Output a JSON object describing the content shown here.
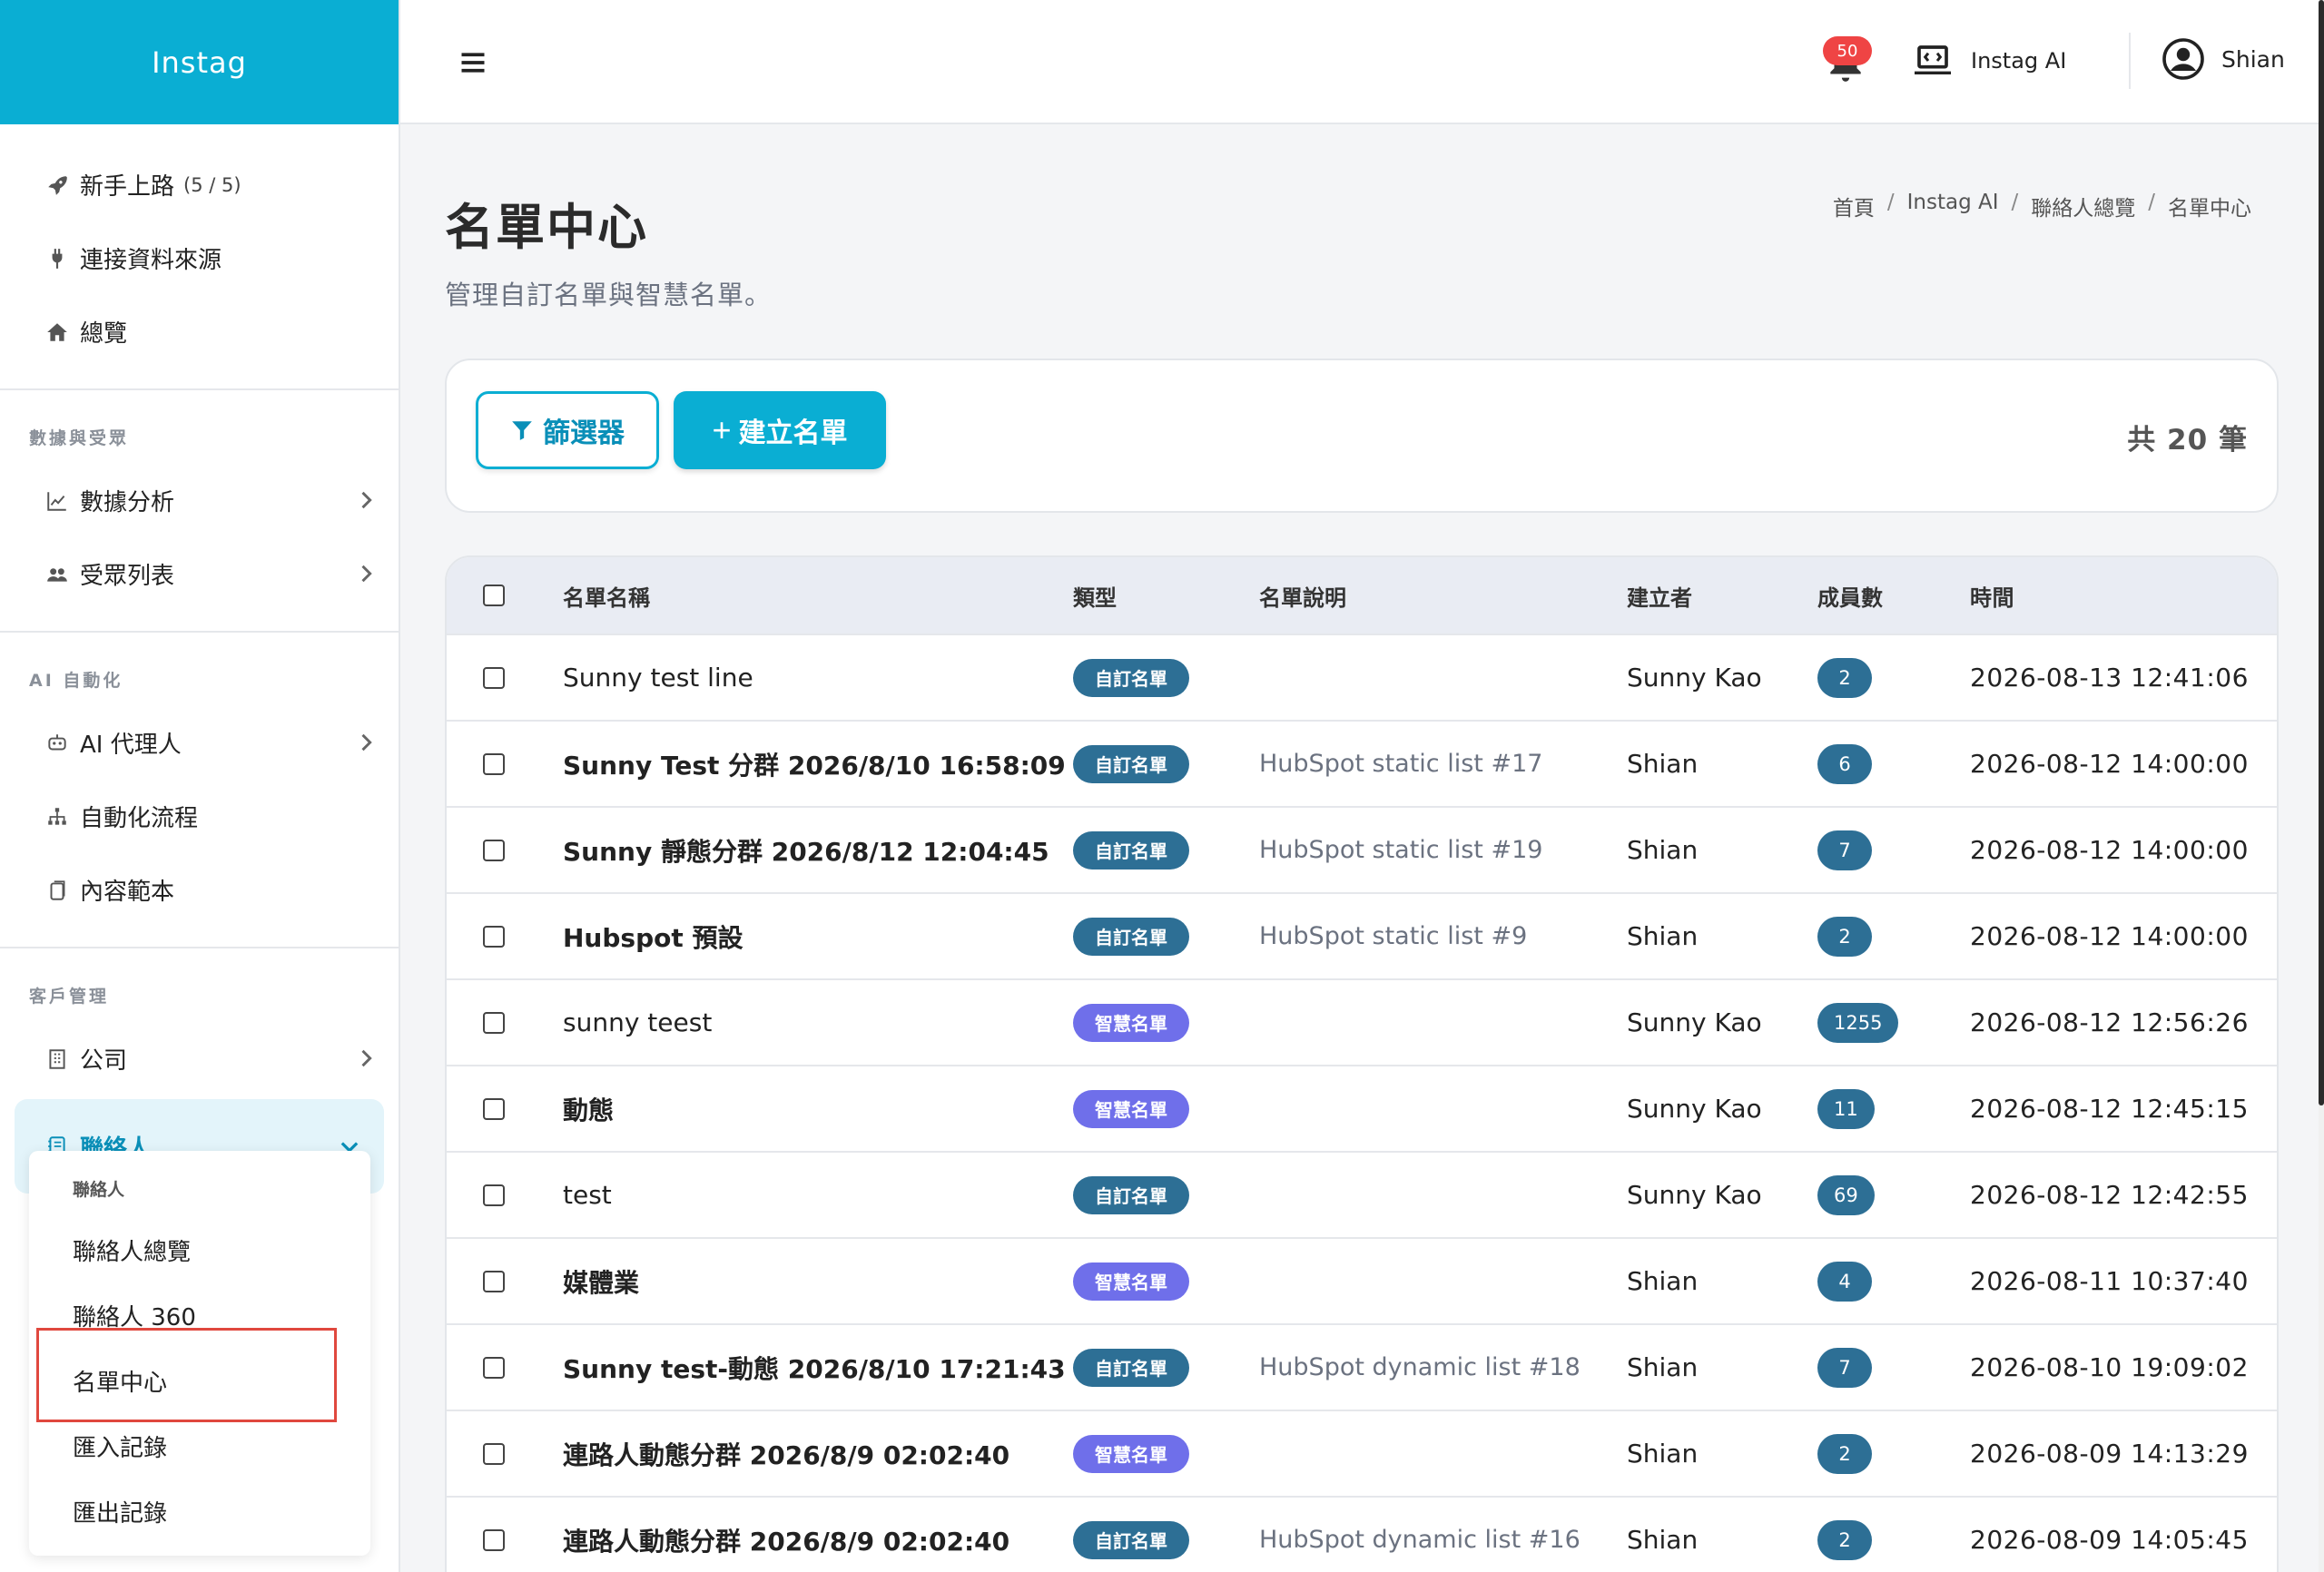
{
  "sidebar": {
    "brand": "Instag",
    "top_items": [
      {
        "label": "新手上路",
        "count": "(5 / 5)"
      },
      {
        "label": "連接資料來源"
      },
      {
        "label": "總覽"
      }
    ],
    "groups": [
      {
        "title": "數據與受眾",
        "items": [
          {
            "label": "數據分析"
          },
          {
            "label": "受眾列表"
          }
        ]
      },
      {
        "title": "AI 自動化",
        "items": [
          {
            "label": "AI 代理人"
          },
          {
            "label": "自動化流程"
          },
          {
            "label": "內容範本"
          }
        ]
      },
      {
        "title": "客戶管理",
        "items": [
          {
            "label": "公司"
          },
          {
            "label": "聯絡人"
          }
        ]
      }
    ],
    "submenu": {
      "title": "聯絡人",
      "items": [
        {
          "label": "聯絡人總覽"
        },
        {
          "label": "聯絡人 360"
        },
        {
          "label": "名單中心"
        },
        {
          "label": "匯入記錄"
        },
        {
          "label": "匯出記錄"
        }
      ]
    }
  },
  "header": {
    "notification_count": "50",
    "ai_label": "Instag AI",
    "user_name": "Shian"
  },
  "page": {
    "title": "名單中心",
    "subtitle": "管理自訂名單與智慧名單。",
    "breadcrumb": [
      "首頁",
      "Instag AI",
      "聯絡人總覽",
      "名單中心"
    ]
  },
  "toolbar": {
    "filter_label": "篩選器",
    "create_label": "建立名單",
    "total_label": "共 20 筆"
  },
  "colors": {
    "accent": "#0aaed3",
    "tag_custom": "#2d6f95",
    "tag_smart": "#6f6fea",
    "count_pill": "#2d6f95",
    "highlight": "#e0483e"
  },
  "table": {
    "columns": [
      "名單名稱",
      "類型",
      "名單說明",
      "建立者",
      "成員數",
      "時間"
    ],
    "rows": [
      {
        "name": "Sunny test line",
        "type": "自訂名單",
        "desc": "",
        "owner": "Sunny Kao",
        "count": "2",
        "time": "2026-08-13 12:41:06"
      },
      {
        "name": "Sunny Test 分群 2026/8/10 16:58:09",
        "type": "自訂名單",
        "desc": "HubSpot static list #17",
        "owner": "Shian",
        "count": "6",
        "time": "2026-08-12 14:00:00"
      },
      {
        "name": "Sunny 靜態分群 2026/8/12 12:04:45",
        "type": "自訂名單",
        "desc": "HubSpot static list #19",
        "owner": "Shian",
        "count": "7",
        "time": "2026-08-12 14:00:00"
      },
      {
        "name": "Hubspot 預設",
        "type": "自訂名單",
        "desc": "HubSpot static list #9",
        "owner": "Shian",
        "count": "2",
        "time": "2026-08-12 14:00:00"
      },
      {
        "name": "sunny teest",
        "type": "智慧名單",
        "desc": "",
        "owner": "Sunny Kao",
        "count": "1255",
        "time": "2026-08-12 12:56:26"
      },
      {
        "name": "動態",
        "type": "智慧名單",
        "desc": "",
        "owner": "Sunny Kao",
        "count": "11",
        "time": "2026-08-12 12:45:15"
      },
      {
        "name": "test",
        "type": "自訂名單",
        "desc": "",
        "owner": "Sunny Kao",
        "count": "69",
        "time": "2026-08-12 12:42:55"
      },
      {
        "name": "媒體業",
        "type": "智慧名單",
        "desc": "",
        "owner": "Shian",
        "count": "4",
        "time": "2026-08-11 10:37:40"
      },
      {
        "name": "Sunny test-動態 2026/8/10 17:21:43",
        "type": "自訂名單",
        "desc": "HubSpot dynamic list #18",
        "owner": "Shian",
        "count": "7",
        "time": "2026-08-10 19:09:02"
      },
      {
        "name": "連路人動態分群 2026/8/9 02:02:40",
        "type": "智慧名單",
        "desc": "",
        "owner": "Shian",
        "count": "2",
        "time": "2026-08-09 14:13:29"
      },
      {
        "name": "連路人動態分群 2026/8/9 02:02:40",
        "type": "自訂名單",
        "desc": "HubSpot dynamic list #16",
        "owner": "Shian",
        "count": "2",
        "time": "2026-08-09 14:05:45"
      }
    ]
  }
}
